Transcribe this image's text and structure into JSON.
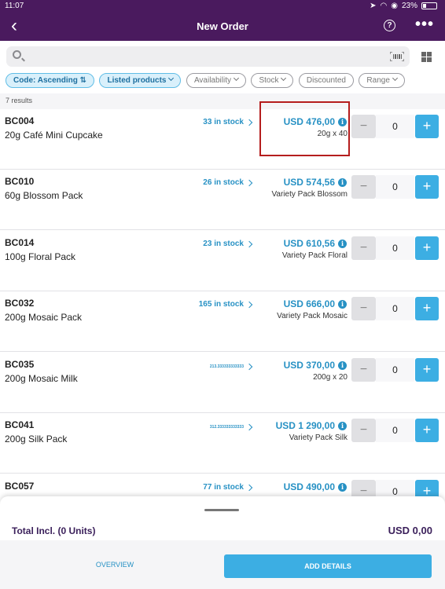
{
  "status_bar": {
    "time": "11:07",
    "battery": "23%"
  },
  "header": {
    "title": "New Order",
    "help_icon": "?",
    "more_icon": "•••"
  },
  "search": {
    "placeholder": ""
  },
  "filters": [
    {
      "label": "Code: Ascending ⇅",
      "active": true
    },
    {
      "label": "Listed products",
      "active": true
    },
    {
      "label": "Availability",
      "active": false
    },
    {
      "label": "Stock",
      "active": false
    },
    {
      "label": "Discounted",
      "active": false
    },
    {
      "label": "Range",
      "active": false
    }
  ],
  "results_count": "7 results",
  "products": [
    {
      "code": "BC004",
      "name": "20g Café Mini Cupcake",
      "stock": "33 in stock",
      "price": "USD 476,00",
      "pack": "20g x 40",
      "quantity": "0"
    },
    {
      "code": "BC010",
      "name": "60g Blossom Pack",
      "stock": "26 in stock",
      "price": "USD 574,56",
      "pack": "Variety Pack Blossom",
      "quantity": "0"
    },
    {
      "code": "BC014",
      "name": "100g Floral Pack",
      "stock": "23 in stock",
      "price": "USD 610,56",
      "pack": "Variety Pack Floral",
      "quantity": "0"
    },
    {
      "code": "BC032",
      "name": "200g Mosaic Pack",
      "stock": "165 in stock",
      "price": "USD 666,00",
      "pack": "Variety Pack Mosaic",
      "quantity": "0"
    },
    {
      "code": "BC035",
      "name": "200g Mosaic Milk",
      "stock": "213.333333333333",
      "price": "USD 370,00",
      "pack": "200g x 20",
      "quantity": "0"
    },
    {
      "code": "BC041",
      "name": "200g Silk Pack",
      "stock": "312.333333333333",
      "price": "USD 1 290,00",
      "pack": "Variety Pack Silk",
      "quantity": "0"
    },
    {
      "code": "BC057",
      "name": "",
      "stock": "77 in stock",
      "price": "USD 490,00",
      "pack": "",
      "quantity": "0"
    }
  ],
  "summary": {
    "total_label": "Total Incl. (0 Units)",
    "total_value": "USD 0,00"
  },
  "actions": {
    "overview": "OVERVIEW",
    "add_details": "ADD DETAILS"
  },
  "colors": {
    "header": "#4a1a5e",
    "accent": "#2791c4",
    "button": "#3caee3",
    "highlight": "#b51d1d"
  }
}
